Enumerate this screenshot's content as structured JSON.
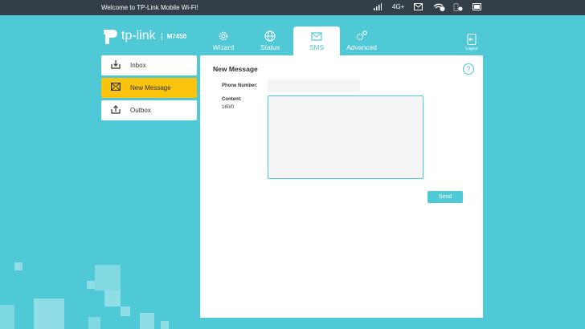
{
  "topbar": {
    "welcome": "Welcome to TP-Link Mobile Wi-Fi!",
    "network": "4G+",
    "wifi_clients": "0",
    "devices": "0"
  },
  "logo": {
    "brand": "tp-link",
    "model": "M7450"
  },
  "nav": {
    "tabs": [
      {
        "label": "Wizard",
        "icon": "gear-icon"
      },
      {
        "label": "Status",
        "icon": "globe-icon"
      },
      {
        "label": "SMS",
        "icon": "envelope-icon"
      },
      {
        "label": "Advanced",
        "icon": "gears-icon"
      }
    ],
    "active": "SMS",
    "logout": "Logout"
  },
  "sidebar": {
    "items": [
      {
        "label": "Inbox"
      },
      {
        "label": "New Message"
      },
      {
        "label": "Outbox"
      }
    ]
  },
  "main": {
    "title": "New Message",
    "phone_label": "Phone Number:",
    "phone_value": "",
    "content_label": "Content:",
    "counter": "160/0",
    "content_value": "",
    "send_label": "Send"
  },
  "colors": {
    "accent": "#4ec9d5",
    "active": "#fac30d",
    "topbar": "#333f48"
  }
}
